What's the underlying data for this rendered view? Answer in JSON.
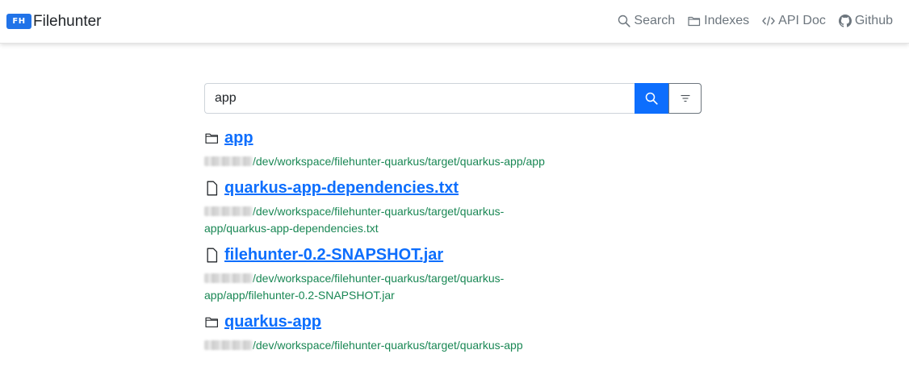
{
  "brand": {
    "logo": "FH",
    "name": "Filehunter",
    "color": "#2173e8"
  },
  "nav": {
    "search": {
      "label": "Search",
      "icon": "search-icon"
    },
    "indexes": {
      "label": "Indexes",
      "icon": "folder-icon"
    },
    "api_doc": {
      "label": "API Doc",
      "icon": "code-icon"
    },
    "github": {
      "label": "Github",
      "icon": "github-icon"
    }
  },
  "search": {
    "value": "app",
    "button_color": "#0d6efd"
  },
  "results": [
    {
      "type": "folder",
      "title": "app",
      "path": "/dev/workspace/filehunter-quarkus/target/quarkus-app/app"
    },
    {
      "type": "file",
      "title": "quarkus-app-dependencies.txt",
      "path": "/dev/workspace/filehunter-quarkus/target/quarkus-app/quarkus-app-dependencies.txt"
    },
    {
      "type": "file",
      "title": "filehunter-0.2-SNAPSHOT.jar",
      "path": "/dev/workspace/filehunter-quarkus/target/quarkus-app/app/filehunter-0.2-SNAPSHOT.jar"
    },
    {
      "type": "folder",
      "title": "quarkus-app",
      "path": "/dev/workspace/filehunter-quarkus/target/quarkus-app"
    }
  ]
}
